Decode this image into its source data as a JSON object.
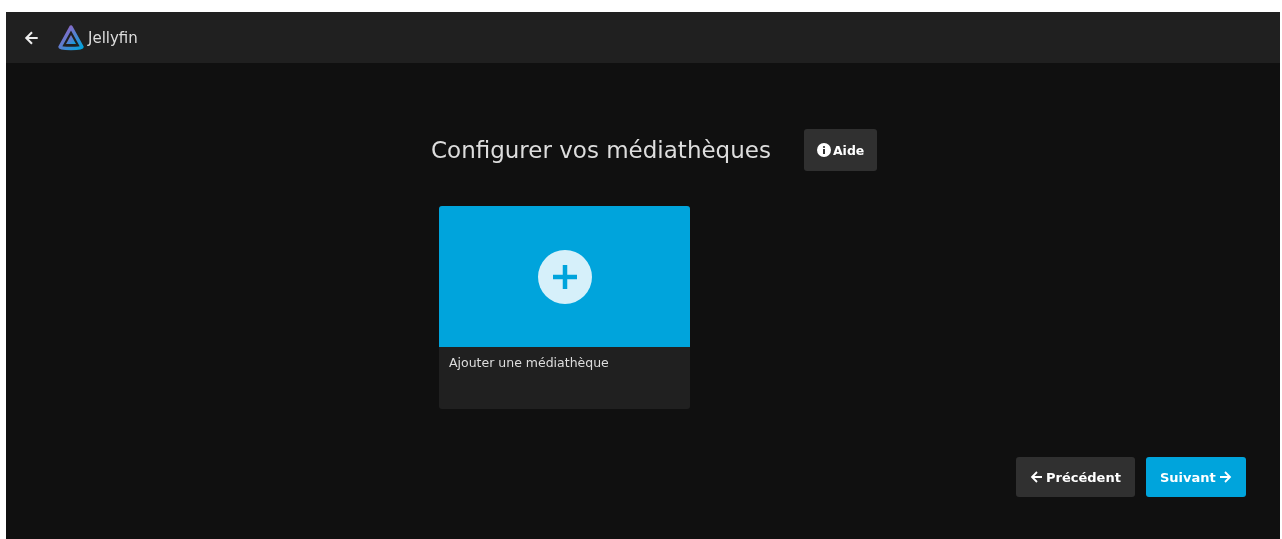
{
  "header": {
    "app_name": "Jellyfin"
  },
  "title": "Configurer vos médiathèques",
  "help_button": {
    "label": "Aide"
  },
  "libraries": [
    {
      "kind": "add",
      "label": "Ajouter une médiathèque"
    }
  ],
  "buttons": [
    {
      "kind": "back",
      "label": "Précédent"
    },
    {
      "kind": "next",
      "label": "Suivant"
    }
  ]
}
